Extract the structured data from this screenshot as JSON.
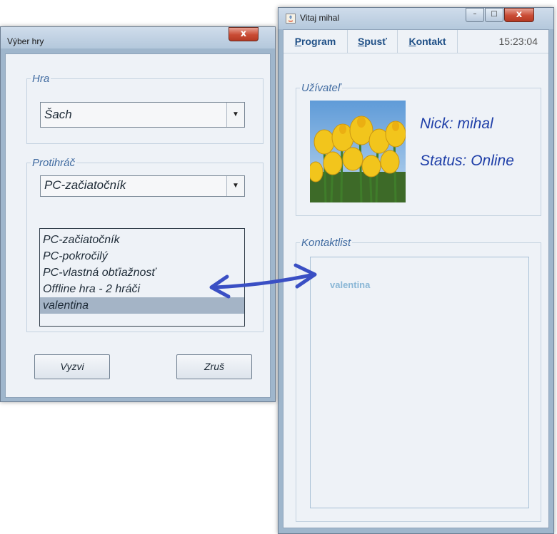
{
  "select_game_window": {
    "title": "Výber hry",
    "close_label": "x",
    "game_group": {
      "legend": "Hra",
      "selected": "Šach"
    },
    "opponent_group": {
      "legend": "Protihráč",
      "selected": "PC-začiatočník",
      "options": [
        "PC-začiatočník",
        "PC-pokročilý",
        "PC-vlastná obťiažnosť",
        "Offline hra - 2 hráči",
        "valentina"
      ],
      "highlighted_index": 4
    },
    "challenge_button": "Vyzvi",
    "cancel_button": "Zruš"
  },
  "main_window": {
    "title": "Vitaj mihal",
    "minimize_label": "–",
    "maximize_label": "□",
    "close_label": "x",
    "menu": {
      "program": {
        "first": "P",
        "rest": "rogram"
      },
      "spust": {
        "first": "S",
        "rest": "pusť"
      },
      "kontakt": {
        "first": "K",
        "rest": "ontakt"
      }
    },
    "clock": "15:23:04",
    "user_group": {
      "legend": "Užívateľ",
      "nick": "Nick: mihal",
      "status": "Status: Online"
    },
    "contacts_group": {
      "legend": "Kontaktlist",
      "contacts": [
        "valentina"
      ]
    }
  },
  "colors": {
    "legend_text": "#3f6aa0",
    "contact_text": "#8ab7d6",
    "annotation_arrow": "#3a4fc4"
  }
}
